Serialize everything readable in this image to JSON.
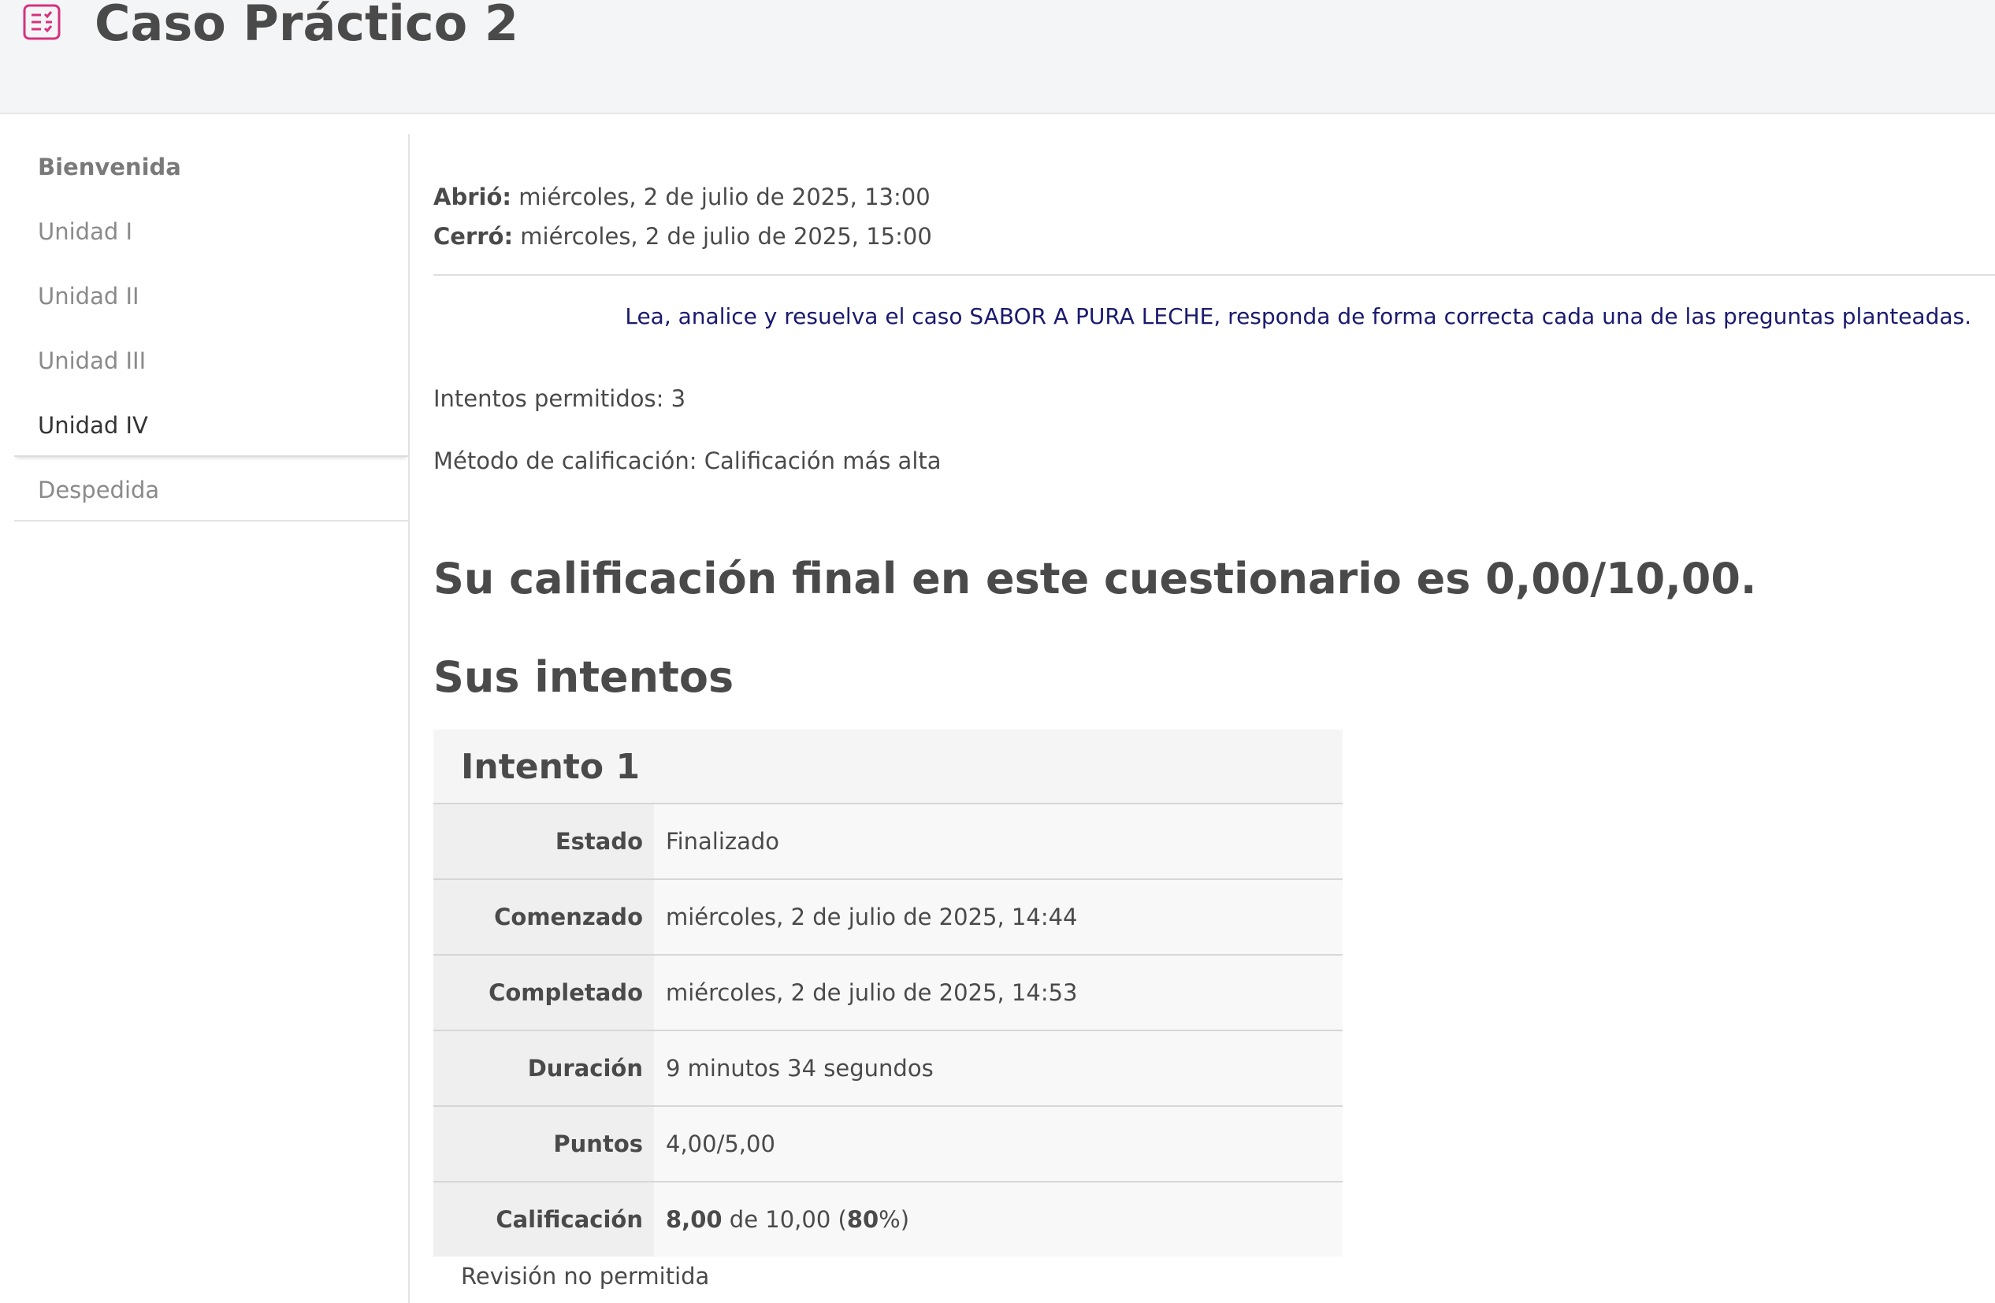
{
  "header": {
    "title": "Caso Práctico 2",
    "icon": "quiz-icon",
    "icon_color": "#d6327e"
  },
  "sidebar": {
    "items": [
      {
        "label": "Bienvenida"
      },
      {
        "label": "Unidad I"
      },
      {
        "label": "Unidad II"
      },
      {
        "label": "Unidad III"
      },
      {
        "label": "Unidad IV",
        "active": true
      },
      {
        "label": "Despedida"
      }
    ]
  },
  "main": {
    "opened_label": "Abrió:",
    "opened_value": "miércoles, 2 de julio de 2025, 13:00",
    "closed_label": "Cerró:",
    "closed_value": "miércoles, 2 de julio de 2025, 15:00",
    "intro": "Lea, analice y resuelva el caso SABOR A PURA LECHE, responda de forma correcta cada una de las preguntas planteadas.",
    "attempts_allowed": "Intentos permitidos: 3",
    "grading_method": "Método de calificación: Calificación más alta",
    "final_grade": "Su calificación final en este cuestionario es 0,00/10,00.",
    "attempts_title": "Sus intentos",
    "attempt": {
      "title": "Intento 1",
      "rows": [
        {
          "key": "Estado",
          "value": "Finalizado"
        },
        {
          "key": "Comenzado",
          "value": "miércoles, 2 de julio de 2025, 14:44"
        },
        {
          "key": "Completado",
          "value": "miércoles, 2 de julio de 2025, 14:53"
        },
        {
          "key": "Duración",
          "value": "9 minutos 34 segundos"
        },
        {
          "key": "Puntos",
          "value": "4,00/5,00"
        }
      ],
      "grade_key": "Calificación",
      "grade_score": "8,00",
      "grade_mid": " de 10,00 (",
      "grade_pct": "80",
      "grade_end": "%)"
    },
    "review_note": "Revisión no permitida"
  }
}
